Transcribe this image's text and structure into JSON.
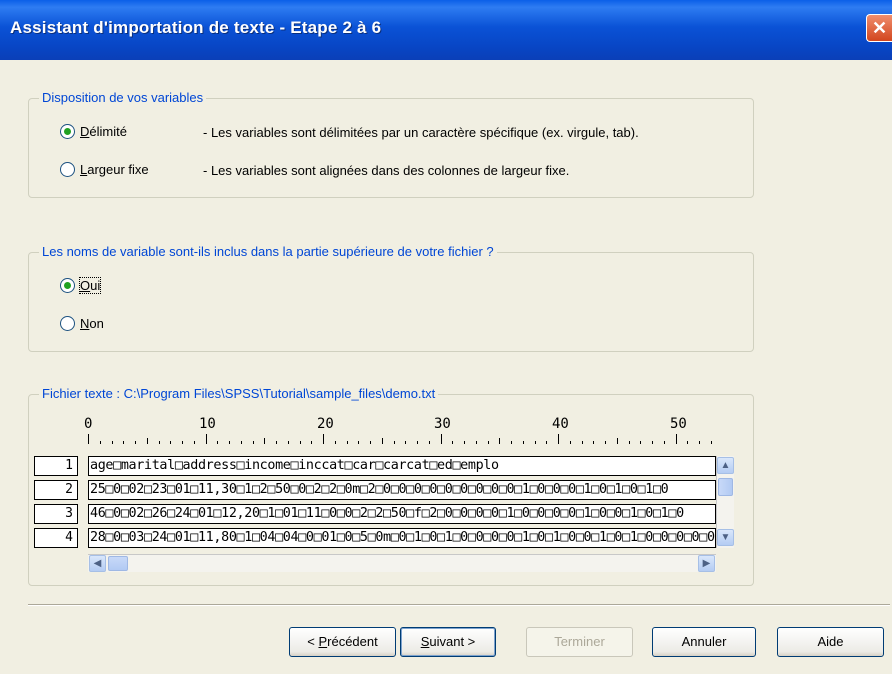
{
  "window": {
    "title": "Assistant d'importation de texte - Etape 2 à 6",
    "close_glyph": "✕"
  },
  "disposition": {
    "legend": "Disposition de vos variables",
    "options": [
      {
        "label": "Délimité",
        "checked": true,
        "description": "- Les variables sont délimitées par un caractère spécifique (ex. virgule, tab)."
      },
      {
        "label": "Largeur fixe",
        "checked": false,
        "description": "- Les variables sont alignées dans des colonnes de largeur fixe."
      }
    ]
  },
  "names_question": {
    "legend": "Les noms de variable sont-ils inclus dans la partie supérieure de votre fichier ?",
    "options": [
      {
        "label": "Oui",
        "checked": true
      },
      {
        "label": "Non",
        "checked": false
      }
    ]
  },
  "file_preview": {
    "legend": "Fichier texte : C:\\Program Files\\SPSS\\Tutorial\\sample_files\\demo.txt",
    "ruler_labels": [
      "0",
      "10",
      "20",
      "30",
      "40",
      "50"
    ],
    "rows": [
      {
        "num": "1",
        "text": "age□marital□address□income□inccat□car□carcat□ed□emplo"
      },
      {
        "num": "2",
        "text": "25□0□02□23□01□11,30□1□2□50□0□2□2□0m□2□0□0□0□0□0□0□0□0□0□1□0□0□0□1□0□1□0□1□0"
      },
      {
        "num": "3",
        "text": "46□0□02□26□24□01□12,20□1□01□11□0□0□2□2□50□f□2□0□0□0□0□1□0□0□0□0□1□0□0□1□0□1□0"
      },
      {
        "num": "4",
        "text": "28□0□03□24□01□11,80□1□04□04□0□01□0□5□0m□0□1□0□1□0□0□0□0□1□0□1□0□0□1□0□1□0□0□0□0□0"
      }
    ],
    "scroll_up": "▲",
    "scroll_down": "▼",
    "scroll_left": "◀",
    "scroll_right": "▶"
  },
  "buttons": {
    "previous": {
      "prefix": "< ",
      "key": "P",
      "rest": "récédent"
    },
    "next": {
      "key": "S",
      "rest": "uivant >"
    },
    "finish": "Terminer",
    "cancel": "Annuler",
    "help": "Aide"
  }
}
